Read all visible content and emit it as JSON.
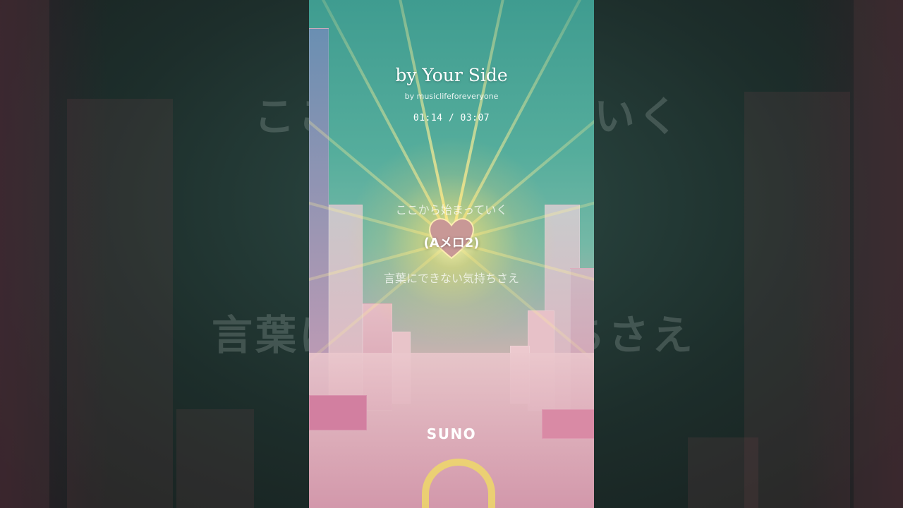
{
  "song": {
    "title": "by Your Side",
    "artist": "by musiclifeforeveryone",
    "elapsed": "01:14",
    "separator": "/",
    "duration": "03:07",
    "time_display": "01:14 / 03:07"
  },
  "lyrics": {
    "previous": "ここから始まっていく",
    "current": "(Aメロ2)",
    "next": "言葉にできない気持ちさえ"
  },
  "background_lyrics": {
    "left_top": "ここ",
    "right_top": "いく",
    "left_bottom": "言葉に",
    "right_bottom": "ちさえ"
  },
  "brand": {
    "logo_text": "SUNO"
  },
  "colors": {
    "sky": "#55ad9c",
    "glow": "#ffe98a",
    "buildings": "#d9a3b0"
  }
}
